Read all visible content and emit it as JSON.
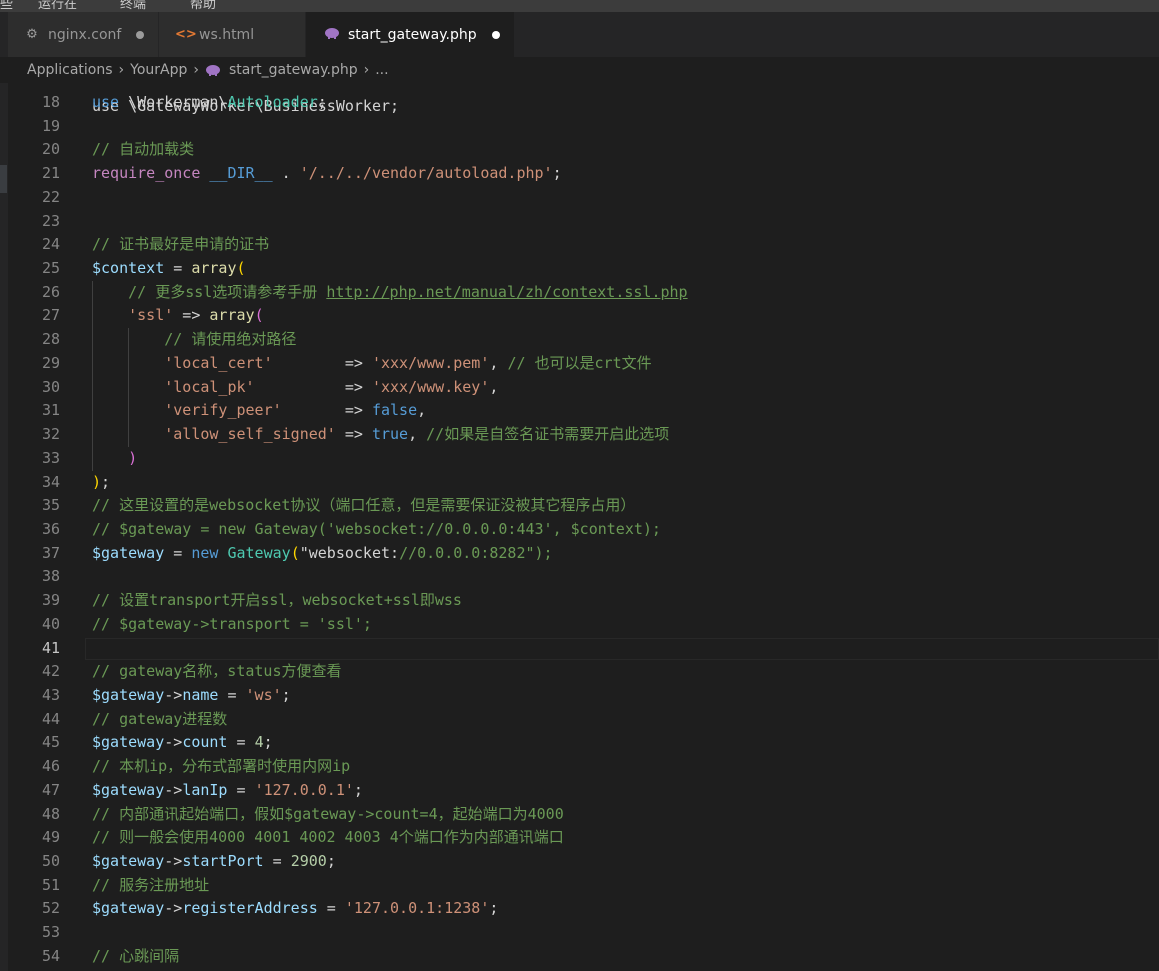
{
  "menubar": {
    "fragments": [
      "些",
      "运行在",
      "终端",
      "帮助"
    ]
  },
  "tabs": [
    {
      "label": "nginx.conf",
      "icon": "gear-icon",
      "dirty": true,
      "active": false
    },
    {
      "label": "ws.html",
      "icon": "html-icon",
      "dirty": false,
      "active": false
    },
    {
      "label": "start_gateway.php",
      "icon": "php-elephant-icon",
      "dirty": true,
      "active": true
    }
  ],
  "breadcrumb": {
    "items": [
      "Applications",
      "YourApp",
      "start_gateway.php",
      "..."
    ]
  },
  "editor": {
    "current_line": 41,
    "partial_top": "use \\GatewayWorker\\BusinessWorker;",
    "lines": [
      {
        "n": 18,
        "text": "use \\Workerman\\Autoloader;"
      },
      {
        "n": 19,
        "text": ""
      },
      {
        "n": 20,
        "text": "// 自动加载类"
      },
      {
        "n": 21,
        "text": "require_once __DIR__ . '/../../vendor/autoload.php';"
      },
      {
        "n": 22,
        "text": ""
      },
      {
        "n": 23,
        "text": ""
      },
      {
        "n": 24,
        "text": "// 证书最好是申请的证书"
      },
      {
        "n": 25,
        "text": "$context = array("
      },
      {
        "n": 26,
        "text": "    // 更多ssl选项请参考手册 http://php.net/manual/zh/context.ssl.php"
      },
      {
        "n": 27,
        "text": "    'ssl' => array("
      },
      {
        "n": 28,
        "text": "        // 请使用绝对路径"
      },
      {
        "n": 29,
        "text": "        'local_cert'        => 'xxx/www.pem', // 也可以是crt文件"
      },
      {
        "n": 30,
        "text": "        'local_pk'          => 'xxx/www.key',"
      },
      {
        "n": 31,
        "text": "        'verify_peer'       => false,"
      },
      {
        "n": 32,
        "text": "        'allow_self_signed' => true, //如果是自签名证书需要开启此选项"
      },
      {
        "n": 33,
        "text": "    )"
      },
      {
        "n": 34,
        "text": ");"
      },
      {
        "n": 35,
        "text": "// 这里设置的是websocket协议（端口任意，但是需要保证没被其它程序占用）"
      },
      {
        "n": 36,
        "text": "// $gateway = new Gateway('websocket://0.0.0.0:443', $context);"
      },
      {
        "n": 37,
        "text": "$gateway = new Gateway(\"websocket://0.0.0.0:8282\");"
      },
      {
        "n": 38,
        "text": ""
      },
      {
        "n": 39,
        "text": "// 设置transport开启ssl，websocket+ssl即wss"
      },
      {
        "n": 40,
        "text": "// $gateway->transport = 'ssl';"
      },
      {
        "n": 41,
        "text": ""
      },
      {
        "n": 42,
        "text": "// gateway名称，status方便查看"
      },
      {
        "n": 43,
        "text": "$gateway->name = 'ws';"
      },
      {
        "n": 44,
        "text": "// gateway进程数"
      },
      {
        "n": 45,
        "text": "$gateway->count = 4;"
      },
      {
        "n": 46,
        "text": "// 本机ip，分布式部署时使用内网ip"
      },
      {
        "n": 47,
        "text": "$gateway->lanIp = '127.0.0.1';"
      },
      {
        "n": 48,
        "text": "// 内部通讯起始端口，假如$gateway->count=4，起始端口为4000"
      },
      {
        "n": 49,
        "text": "// 则一般会使用4000 4001 4002 4003 4个端口作为内部通讯端口"
      },
      {
        "n": 50,
        "text": "$gateway->startPort = 2900;"
      },
      {
        "n": 51,
        "text": "// 服务注册地址"
      },
      {
        "n": 52,
        "text": "$gateway->registerAddress = '127.0.0.1:1238';"
      },
      {
        "n": 53,
        "text": ""
      },
      {
        "n": 54,
        "text": "// 心跳间隔"
      }
    ]
  },
  "colors": {
    "background": "#1e1e1e",
    "keyword": "#569cd6",
    "control": "#c586c0",
    "type": "#4ec9b0",
    "string": "#ce9178",
    "number": "#b5cea8",
    "variable": "#9cdcfe",
    "comment": "#6a9955"
  }
}
